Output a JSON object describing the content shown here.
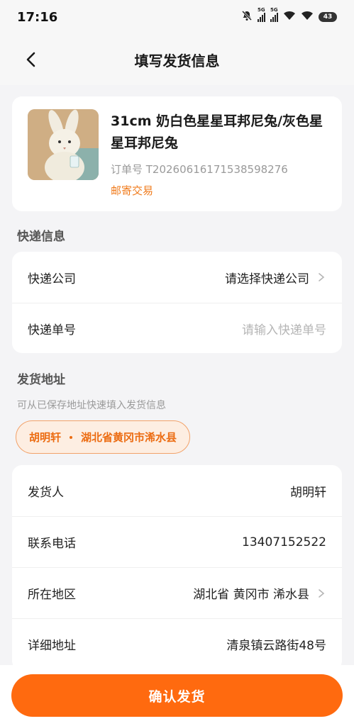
{
  "status_bar": {
    "time": "17:16",
    "network_1": "5G",
    "network_2": "5G",
    "battery": "43"
  },
  "nav": {
    "title": "填写发货信息"
  },
  "product": {
    "title": "31cm 奶白色星星耳邦尼兔/灰色星星耳邦尼兔",
    "order_no": "订单号 T20260616171538598276",
    "trade_type": "邮寄交易"
  },
  "express": {
    "section_title": "快递信息",
    "company_label": "快递公司",
    "company_value": "请选择快递公司",
    "number_label": "快递单号",
    "number_placeholder": "请输入快递单号"
  },
  "sender": {
    "section_title": "发货地址",
    "hint": "可从已保存地址快速填入发货信息",
    "saved_address": {
      "name": "胡明轩",
      "region": "湖北省黄冈市浠水县"
    },
    "fields": [
      {
        "label": "发货人",
        "value": "胡明轩"
      },
      {
        "label": "联系电话",
        "value": "13407152522"
      },
      {
        "label": "所在地区",
        "value": "湖北省 黄冈市 浠水县"
      },
      {
        "label": "详细地址",
        "value": "清泉镇云路街48号"
      }
    ]
  },
  "footer": {
    "confirm_label": "确认发货"
  },
  "colors": {
    "accent": "#ff6a0f",
    "accent_text": "#ec6c12",
    "background": "#f4f4f6"
  }
}
